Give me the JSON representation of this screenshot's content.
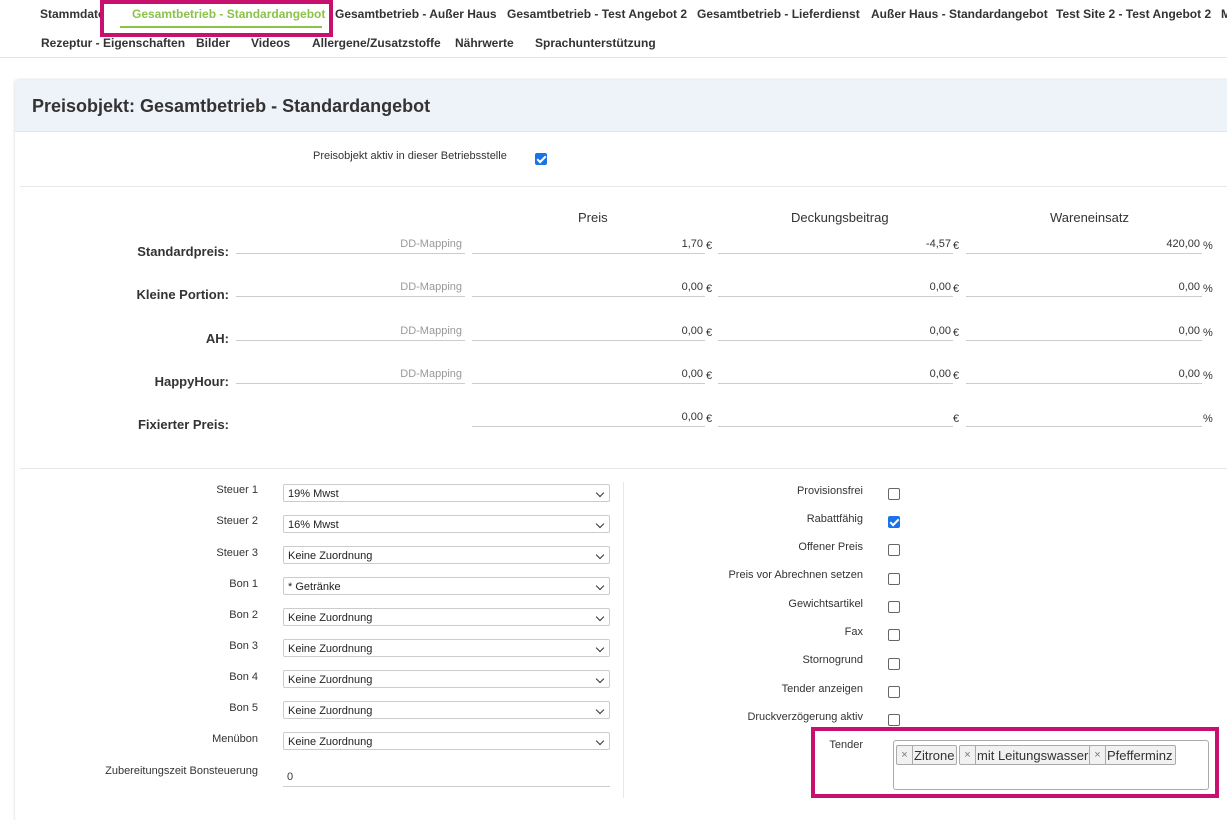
{
  "tabs": {
    "row1": [
      "Stammdaten",
      "Gesamtbetrieb - Standardangebot",
      "Gesamtbetrieb - Außer Haus",
      "Gesamtbetrieb - Test Angebot 2",
      "Gesamtbetrieb - Lieferdienst",
      "Außer Haus - Standardangebot",
      "Test Site 2 - Test Angebot 2",
      "M"
    ],
    "row2": [
      "Rezeptur - Eigenschaften",
      "Bilder",
      "Videos",
      "Allergene/Zusatzstoffe",
      "Nährwerte",
      "Sprachunterstützung"
    ],
    "active_label": "Gesamtbetrieb - Standardangebot"
  },
  "card": {
    "title": "Preisobjekt: Gesamtbetrieb - Standardangebot"
  },
  "active_toggle": {
    "label": "Preisobjekt aktiv in dieser Betriebsstelle",
    "checked": true
  },
  "price_table": {
    "headers": [
      "Preis",
      "Deckungsbeitrag",
      "Wareneinsatz"
    ],
    "mapping_placeholder": "DD-Mapping",
    "rows": [
      {
        "label": "Standardpreis:",
        "mapping": "DD-Mapping",
        "preis": "1,70",
        "db": "-4,57",
        "we": "420,00"
      },
      {
        "label": "Kleine Portion:",
        "mapping": "DD-Mapping",
        "preis": "0,00",
        "db": "0,00",
        "we": "0,00"
      },
      {
        "label": "AH:",
        "mapping": "DD-Mapping",
        "preis": "0,00",
        "db": "0,00",
        "we": "0,00"
      },
      {
        "label": "HappyHour:",
        "mapping": "DD-Mapping",
        "preis": "0,00",
        "db": "0,00",
        "we": "0,00"
      },
      {
        "label": "Fixierter Preis:",
        "mapping": "",
        "preis": "0,00",
        "db": "",
        "we": ""
      }
    ],
    "currency": "€",
    "percent": "%"
  },
  "selects": [
    {
      "label": "Steuer 1",
      "value": "19% Mwst"
    },
    {
      "label": "Steuer 2",
      "value": "16% Mwst"
    },
    {
      "label": "Steuer 3",
      "value": "Keine Zuordnung"
    },
    {
      "label": "Bon 1",
      "value": "* Getränke"
    },
    {
      "label": "Bon 2",
      "value": "Keine Zuordnung"
    },
    {
      "label": "Bon 3",
      "value": "Keine Zuordnung"
    },
    {
      "label": "Bon 4",
      "value": "Keine Zuordnung"
    },
    {
      "label": "Bon 5",
      "value": "Keine Zuordnung"
    },
    {
      "label": "Menübon",
      "value": "Keine Zuordnung"
    }
  ],
  "zubereitung": {
    "label": "Zubereitungszeit Bonsteuerung",
    "value": "0"
  },
  "checkboxes": [
    {
      "label": "Provisionsfrei",
      "checked": false
    },
    {
      "label": "Rabattfähig",
      "checked": true
    },
    {
      "label": "Offener Preis",
      "checked": false
    },
    {
      "label": "Preis vor Abrechnen setzen",
      "checked": false
    },
    {
      "label": "Gewichtsartikel",
      "checked": false
    },
    {
      "label": "Fax",
      "checked": false
    },
    {
      "label": "Stornogrund",
      "checked": false
    },
    {
      "label": "Tender anzeigen",
      "checked": false
    },
    {
      "label": "Druckverzögerung aktiv",
      "checked": false
    }
  ],
  "tender": {
    "label": "Tender",
    "tags": [
      "Zitrone",
      "mit Leitungswasser",
      "Pfefferminz"
    ],
    "remove_symbol": "×"
  },
  "colors": {
    "accent_green": "#8bc34a",
    "highlight": "#c8106e",
    "checkbox_blue": "#1a73e8"
  }
}
